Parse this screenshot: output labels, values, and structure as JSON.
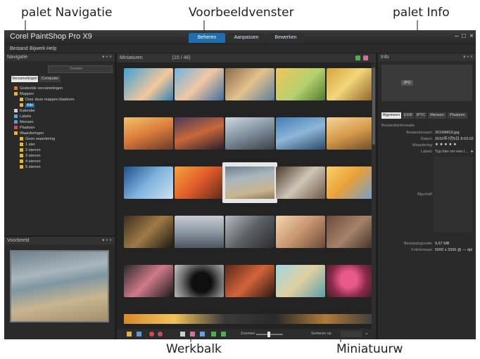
{
  "callouts": {
    "navigation": "palet Navigatie",
    "preview_window": "Voorbeeldvenster",
    "info": "palet Info",
    "toolbar": "Werkbalk",
    "thumbnails": "Miniatuurw"
  },
  "app": {
    "title": "Corel PaintShop Pro X9",
    "window_controls": {
      "minimize": "–",
      "maximize": "□",
      "close": "×"
    },
    "mode_tabs": [
      "Beheren",
      "Aanpassen",
      "Bewerken"
    ],
    "menu": [
      "Bestand",
      "Bijwerk",
      "Help"
    ]
  },
  "navigation": {
    "header": "Navigatie",
    "search_placeholder": "Zoeken",
    "tabs": [
      "Verzamelingen",
      "Computer"
    ],
    "tree": [
      "Gedeelde verzamelingen",
      "Mappen",
      "Door deze mappen bladeren",
      "Alle",
      "Kalender",
      "Labels",
      "Mensen",
      "Plaatsen",
      "Waarderingen",
      "Geen waardering",
      "1 ster",
      "2 sterren",
      "3 sterren",
      "4 sterren",
      "5 sterren"
    ]
  },
  "preview": {
    "header": "Voorbeeld"
  },
  "thumbnails": {
    "header": "Miniaturen",
    "count": "(15 / 46)"
  },
  "toolbar": {
    "zoom_label": "Zoomen",
    "sort_label": "Sorteren op"
  },
  "info": {
    "header": "Info",
    "format_badge": "JPG",
    "tabs": [
      "Algemeen",
      "EXIF",
      "IPTC",
      "Mensen",
      "Plaatsen"
    ],
    "section": "Bestandsinformatie",
    "fields": [
      {
        "label": "Bestandsnaam",
        "value": "2019IMG9.jpg"
      },
      {
        "label": "Datum",
        "value": "2016年7月5日 8:03:02"
      },
      {
        "label": "Waardering",
        "value": "★ ★ ★ ★ ★"
      },
      {
        "label": "Labels",
        "value": "Typ hier om een l..."
      }
    ],
    "caption_label": "Bijschrift",
    "footer": [
      {
        "label": "Bestandsgrootte",
        "value": "9,67 MB"
      },
      {
        "label": "Fotoformaat",
        "value": "5000 x 3336 @ — dpi"
      }
    ]
  },
  "colors": {
    "app_bg": "#1e1e1e",
    "panel": "#2a2a2a",
    "accent": "#1d6fb0",
    "selected": "#1d6fb0"
  }
}
